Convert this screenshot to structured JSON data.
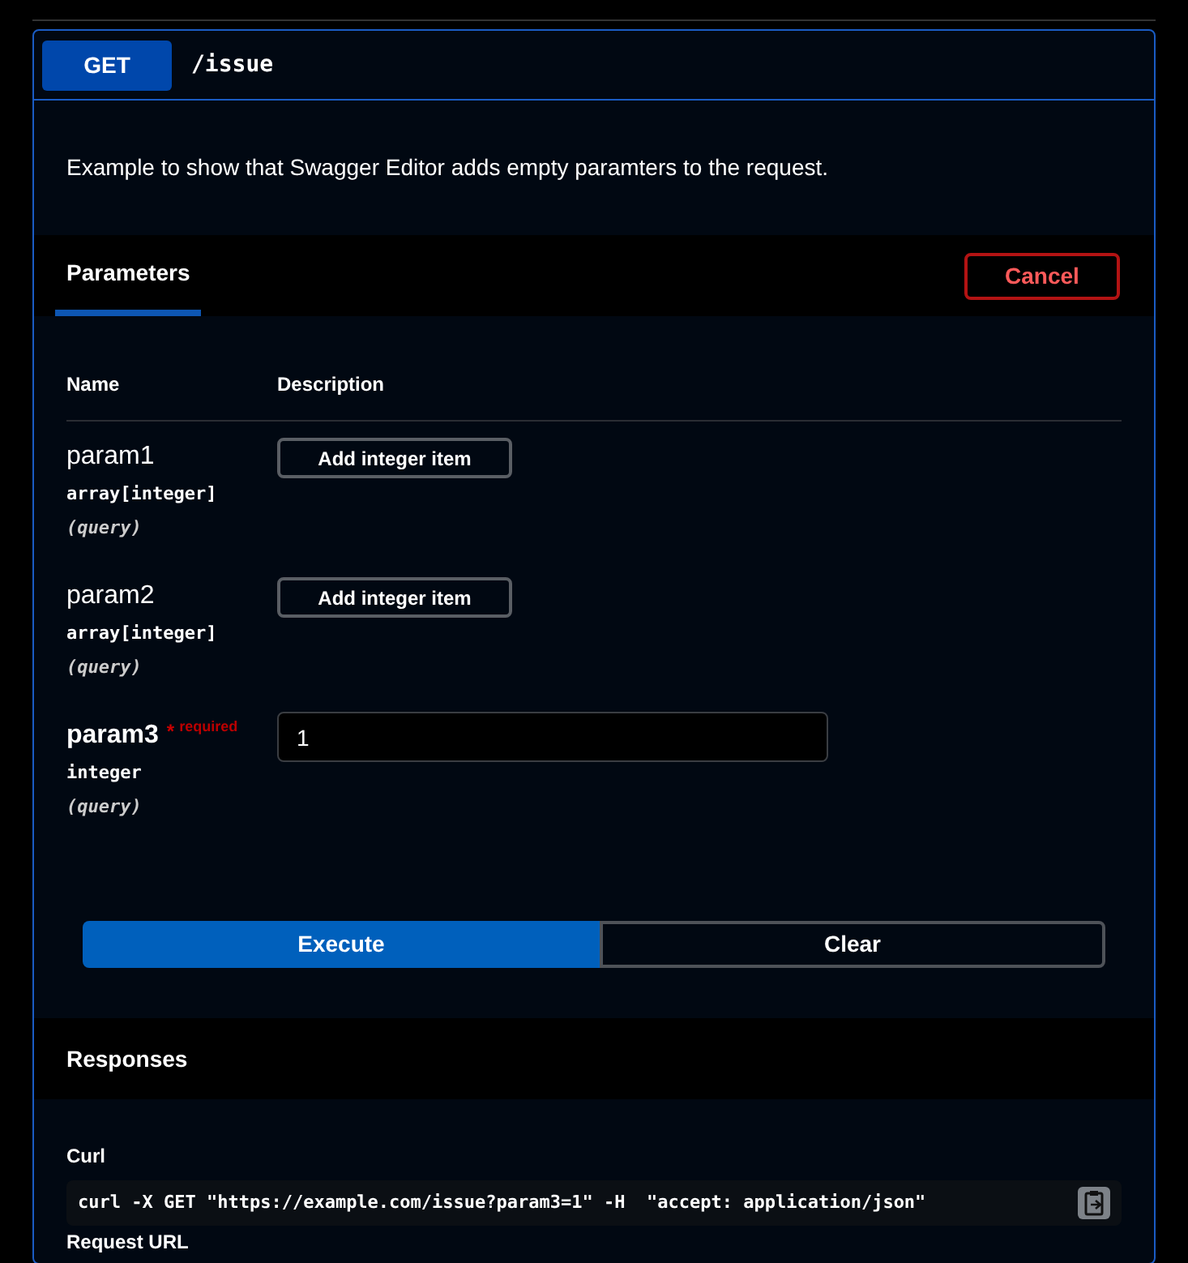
{
  "operation": {
    "method": "GET",
    "path": "/issue",
    "description": "Example to show that Swagger Editor adds empty paramters to the request."
  },
  "parameters": {
    "tab": {
      "label": "Parameters",
      "selected": true
    },
    "cancel": "Cancel",
    "columns": [
      "Name",
      "Description"
    ],
    "rows": [
      {
        "name": "param1",
        "type": "array[integer]",
        "in": "(query)",
        "control": {
          "kind": "add_button",
          "label": "Add integer item"
        }
      },
      {
        "name": "param2",
        "type": "array[integer]",
        "in": "(query)",
        "control": {
          "kind": "add_button",
          "label": "Add integer item"
        }
      },
      {
        "name": "param3",
        "required": {
          "mark": "*",
          "label": "required"
        },
        "type": "integer",
        "in": "(query)",
        "control": {
          "kind": "text_input",
          "value": "1"
        }
      }
    ]
  },
  "actions": [
    "Execute",
    "Clear"
  ],
  "responses": {
    "title": "Responses",
    "curl_label": "Curl",
    "curl": "curl -X GET \"https://example.com/issue?param3=1\" -H  \"accept: application/json\"",
    "request_url_label": "Request URL"
  }
}
